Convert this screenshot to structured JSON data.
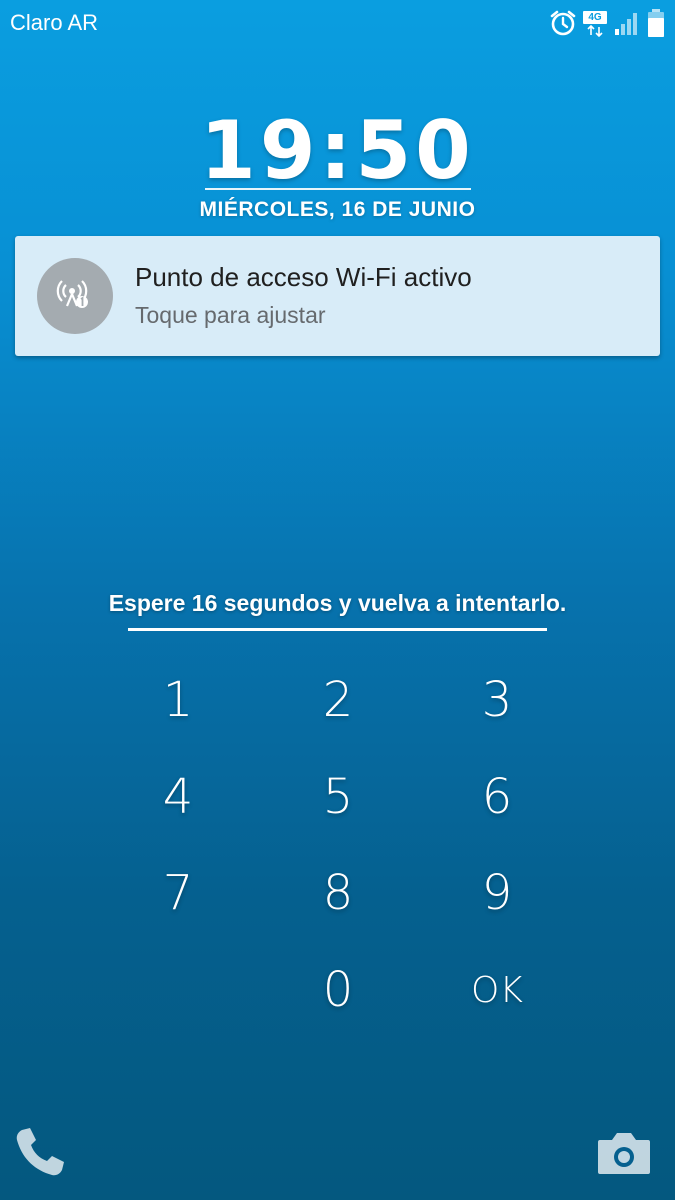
{
  "status_bar": {
    "carrier": "Claro AR",
    "network_badge": "4G",
    "icons": [
      "alarm-icon",
      "network-4g-icon",
      "signal-icon",
      "battery-icon"
    ]
  },
  "lockscreen": {
    "time": "19:50",
    "date": "MIÉRCOLES, 16 DE JUNIO"
  },
  "notification": {
    "icon": "wifi-hotspot-icon",
    "title": "Punto de acceso Wi-Fi activo",
    "subtitle": "Toque para ajustar"
  },
  "pin": {
    "message": "Espere 16 segundos y vuelva a intentarlo.",
    "keys": [
      "1",
      "2",
      "3",
      "4",
      "5",
      "6",
      "7",
      "8",
      "9",
      "0",
      "OK"
    ]
  },
  "shortcuts": {
    "left": "phone-icon",
    "right": "camera-icon"
  },
  "colors": {
    "bg_top": "#0a9ee0",
    "bg_bottom": "#04587f",
    "notification_bg": "#d8ecf8"
  }
}
